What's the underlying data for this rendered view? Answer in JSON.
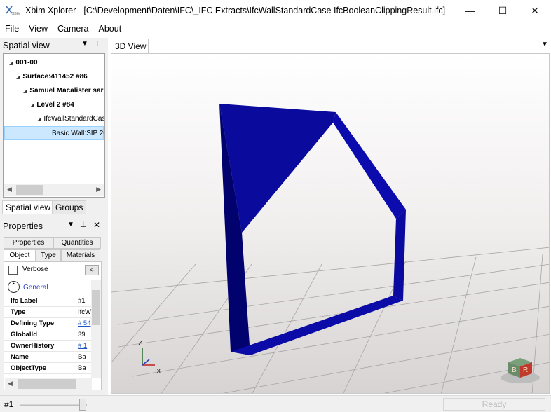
{
  "window": {
    "title": "Xbim Xplorer - [C:\\Development\\Daten\\IFC\\_IFC Extracts\\IfcWallStandardCase IfcBooleanClippingResult.ifc]",
    "logo_text": "XBIM",
    "minimize_icon": "—",
    "maximize_icon": "☐",
    "close_icon": "✕"
  },
  "menu": [
    "File",
    "View",
    "Camera",
    "About"
  ],
  "spatial_panel": {
    "title": "Spatial view",
    "dropdown_icon": "▼",
    "pin_icon": "⊥",
    "tree": [
      {
        "label": "001-00",
        "bold": true,
        "expanded": true
      },
      {
        "label": "Surface:411452 #86",
        "bold": true,
        "expanded": true
      },
      {
        "label": "Samuel Macalister sar",
        "bold": true,
        "expanded": true
      },
      {
        "label": "Level 2 #84",
        "bold": true,
        "expanded": true
      },
      {
        "label": "IfcWallStandardCas",
        "bold": false,
        "expanded": true
      },
      {
        "label": "Basic Wall:SIP 20",
        "bold": false,
        "selected": true
      }
    ],
    "tabs": [
      "Spatial view",
      "Groups"
    ]
  },
  "properties_panel": {
    "title": "Properties",
    "dropdown_icon": "▼",
    "pin_icon": "⊥",
    "close_icon": "✕",
    "top_tabs": [
      "Properties",
      "Quantities"
    ],
    "sub_tabs": [
      "Object",
      "Type",
      "Materials"
    ],
    "verbose_label": "Verbose",
    "verbose_checked": false,
    "collapse_button": "<-",
    "group_label": "General",
    "rows": [
      {
        "key": "Ifc Label",
        "value": "#1",
        "link": false
      },
      {
        "key": "Type",
        "value": "IfcW",
        "link": false
      },
      {
        "key": "Defining Type",
        "value": "# 54",
        "link": true
      },
      {
        "key": "GlobalId",
        "value": "39",
        "link": false
      },
      {
        "key": "OwnerHistory",
        "value": "# 1",
        "link": true
      },
      {
        "key": "Name",
        "value": "Ba",
        "link": false
      },
      {
        "key": "ObjectType",
        "value": "Ba",
        "link": false
      }
    ]
  },
  "view": {
    "tab_label": "3D View",
    "menu_icon": "▼",
    "axis_z": "Z",
    "axis_x": "X",
    "nav_cube_b": "B",
    "nav_cube_r": "R",
    "wall_color": "#0a0a9c"
  },
  "status": {
    "label": "#1",
    "slider_value": 1.0,
    "ready": "Ready"
  }
}
